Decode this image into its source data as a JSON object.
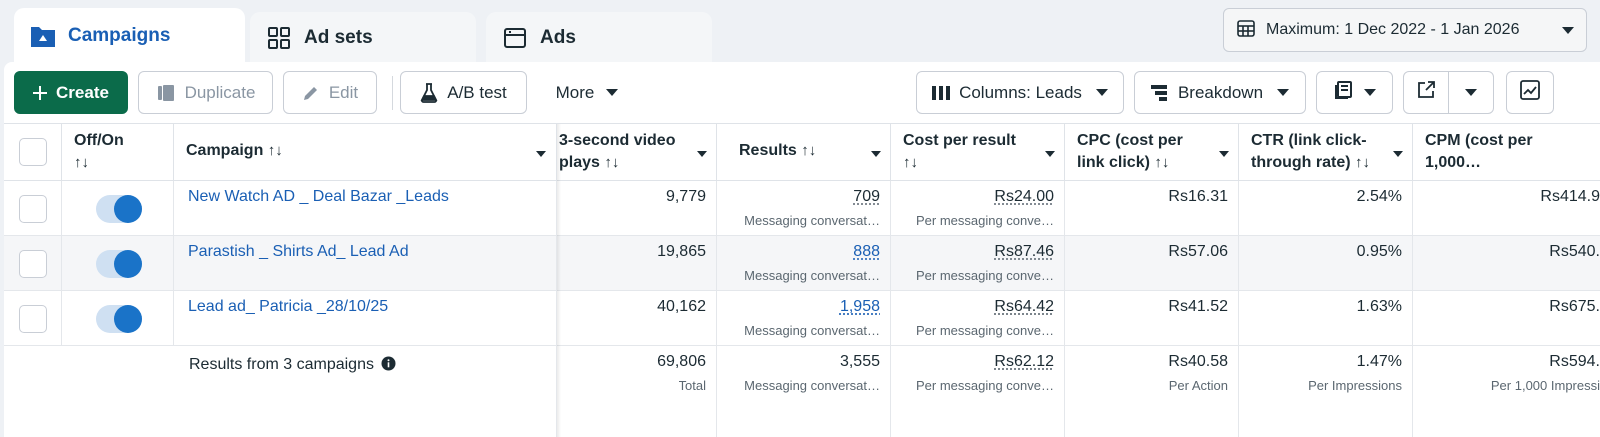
{
  "tabs": [
    {
      "label": "Campaigns",
      "icon": "folder-icon"
    },
    {
      "label": "Ad sets",
      "icon": "grid-icon"
    },
    {
      "label": "Ads",
      "icon": "ad-window-icon"
    }
  ],
  "date_range": {
    "label": "Maximum: 1 Dec 2022 - 1 Jan 2026",
    "icon": "calendar-icon"
  },
  "toolbar": {
    "create": "Create",
    "duplicate": "Duplicate",
    "edit": "Edit",
    "ab_test": "A/B test",
    "more": "More",
    "columns": "Columns: Leads",
    "breakdown": "Breakdown"
  },
  "headers": {
    "off_on": "Off/On",
    "campaign": "Campaign",
    "video_plays_l1": "3-second video",
    "video_plays_l2": "plays",
    "results": "Results",
    "cost_per_result_l1": "Cost per result",
    "cpc_l1": "CPC (cost per",
    "cpc_l2": "link click)",
    "ctr_l1": "CTR (link click-",
    "ctr_l2": "through rate)",
    "cpm_l1": "CPM (cost per",
    "cpm_l2": "1,000…",
    "sort_glyph": "↑↓"
  },
  "rows": [
    {
      "name": "New Watch AD _ Deal Bazar _Leads",
      "plays": "9,779",
      "results": "709",
      "results_sub": "Messaging conversat…",
      "cpr": "Rs24.00",
      "cpr_sub": "Per messaging conve…",
      "cpc": "Rs16.31",
      "ctr": "2.54%",
      "cpm": "Rs414.9"
    },
    {
      "name": "Parastish _ Shirts Ad_ Lead Ad",
      "plays": "19,865",
      "results": "888",
      "results_sub": "Messaging conversat…",
      "cpr": "Rs87.46",
      "cpr_sub": "Per messaging conve…",
      "cpc": "Rs57.06",
      "ctr": "0.95%",
      "cpm": "Rs540."
    },
    {
      "name": "Lead ad_ Patricia _28/10/25",
      "plays": "40,162",
      "results": "1,958",
      "results_sub": "Messaging conversat…",
      "cpr": "Rs64.42",
      "cpr_sub": "Per messaging conve…",
      "cpc": "Rs41.52",
      "ctr": "1.63%",
      "cpm": "Rs675."
    }
  ],
  "summary": {
    "label": "Results from 3 campaigns",
    "plays": "69,806",
    "plays_sub": "Total",
    "results": "3,555",
    "results_sub": "Messaging conversat…",
    "cpr": "Rs62.12",
    "cpr_sub": "Per messaging conve…",
    "cpc": "Rs40.58",
    "cpc_sub": "Per Action",
    "ctr": "1.47%",
    "ctr_sub": "Per Impressions",
    "cpm": "Rs594.",
    "cpm_sub": "Per 1,000 Impressi"
  },
  "colors": {
    "accent": "#1a5fb4",
    "create_button": "#0b6b4a",
    "toggle_on": "#1a73c8"
  }
}
